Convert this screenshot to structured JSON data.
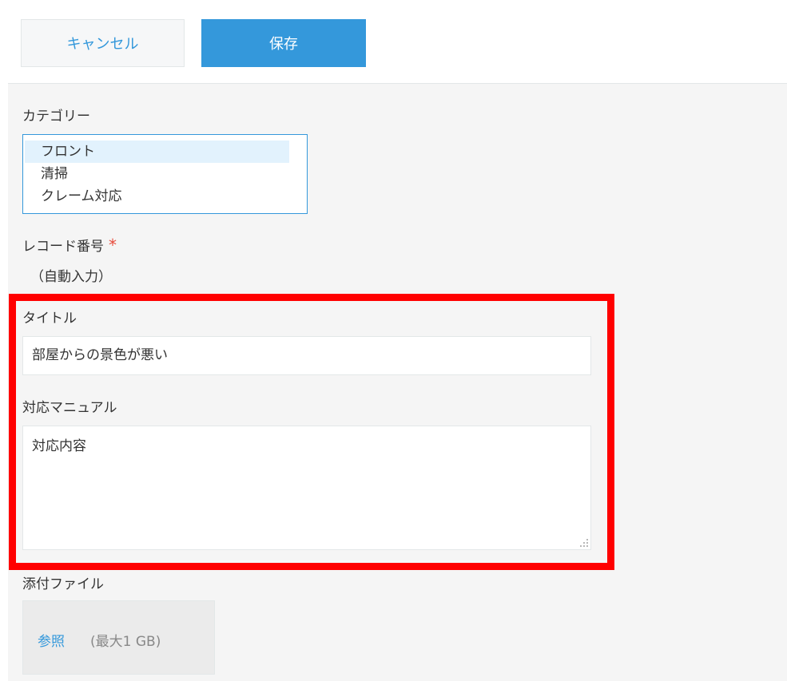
{
  "toolbar": {
    "cancel_label": "キャンセル",
    "save_label": "保存"
  },
  "fields": {
    "category": {
      "label": "カテゴリー",
      "options": [
        "フロント",
        "清掃",
        "クレーム対応"
      ],
      "selected": "フロント"
    },
    "record_number": {
      "label": "レコード番号",
      "required_mark": "*",
      "value": "（自動入力）"
    },
    "title": {
      "label": "タイトル",
      "value": "部屋からの景色が悪い"
    },
    "manual": {
      "label": "対応マニュアル",
      "value": "対応内容"
    },
    "attachment": {
      "label": "添付ファイル",
      "browse_label": "参照",
      "max_size": "(最大1 GB)"
    }
  },
  "colors": {
    "accent": "#3498db",
    "highlight": "#ff0000",
    "required": "#e74c3c",
    "selected_option": "#e2f2fd"
  }
}
